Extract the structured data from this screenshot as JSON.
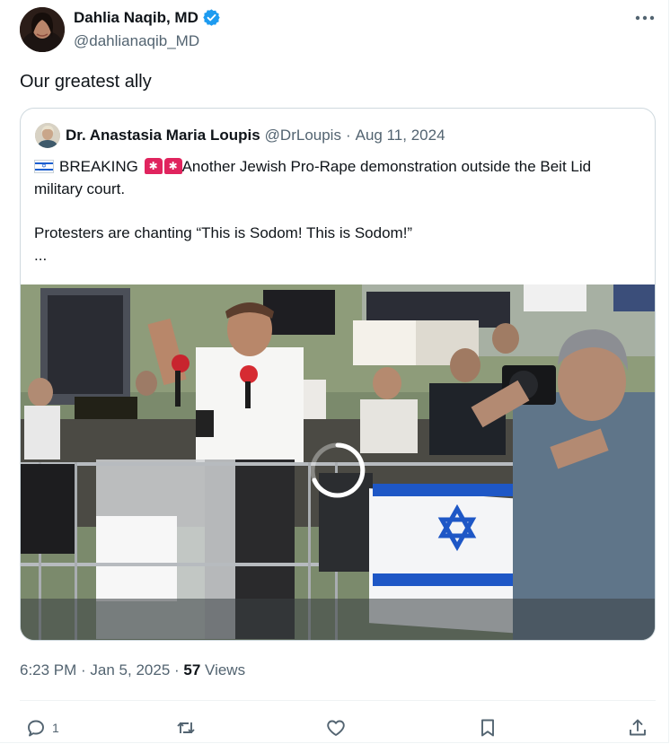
{
  "author": {
    "name": "Dahlia Naqib, MD",
    "handle": "@dahlianaqib_MD",
    "verified": true
  },
  "tweet": {
    "text": "Our greatest ally"
  },
  "quoted": {
    "name": "Dr. Anastasia Maria Loupis",
    "handle": "@DrLoupis",
    "separator": "·",
    "date": "Aug 11, 2024",
    "line1_label": "BREAKING",
    "line1_rest": "Another Jewish Pro-Rape demonstration outside the Beit Lid",
    "line2": "military court.",
    "line3": "Protesters are chanting “This is Sodom! This is Sodom!”",
    "line4": "..."
  },
  "meta": {
    "time": "6:23 PM · Jan 5, 2025 · ",
    "views": "57",
    "views_label": " Views"
  },
  "actions": {
    "reply_count": "1"
  },
  "colors": {
    "text": "#0f1419",
    "muted": "#536471",
    "verified": "#1d9bf0",
    "border": "#cfd9de"
  },
  "icons": [
    "verified-badge-icon",
    "more-icon",
    "israel-flag-icon",
    "siren-icon",
    "reply-icon",
    "retweet-icon",
    "like-icon",
    "bookmark-icon",
    "share-icon",
    "loading-spinner-icon"
  ]
}
